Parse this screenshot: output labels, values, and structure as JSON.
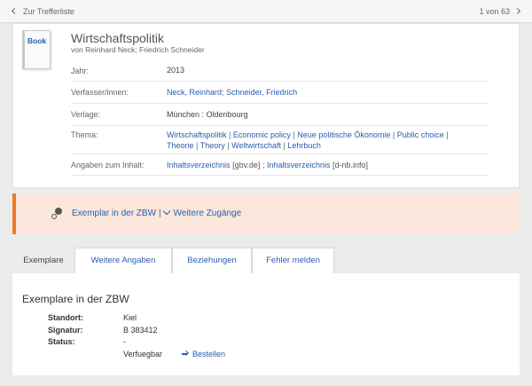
{
  "topbar": {
    "back_label": "Zur Trefferliste",
    "pager": "1 von 63"
  },
  "record": {
    "icon_label": "Book",
    "title": "Wirtschaftspolitik",
    "byline": "von Reinhard Neck; Friedrich Schneider",
    "fields": {
      "jahr": {
        "label": "Jahr:",
        "value": "2013"
      },
      "verfasser": {
        "label": "Verfasser/innen:",
        "authors": [
          "Neck, Reinhard",
          "Schneider, Friedrich"
        ],
        "sep": ";"
      },
      "verlage": {
        "label": "Verlage:",
        "value": "München : Oldenbourg"
      },
      "thema": {
        "label": "Thema:",
        "topics": [
          "Wirtschaftspolitik",
          "Economic policy",
          "Neue politische Ökonomie",
          "Public choice",
          "Theorie",
          "Theory",
          "Weltwirtschaft",
          "Lehrbuch"
        ],
        "sep": "|"
      },
      "inhalt": {
        "label": "Angaben zum Inhalt:",
        "link1": "Inhaltsverzeichnis",
        "source1": "[gbv.de]",
        "sep": ";",
        "link2": "Inhaltsverzeichnis",
        "source2": "[d-nb.info]"
      }
    }
  },
  "access": {
    "zbw_label": "Exemplar in der ZBW",
    "pipe": "|",
    "more_label": "Weitere Zugänge"
  },
  "tabs": {
    "exemplare": "Exemplare",
    "weitere": "Weitere Angaben",
    "beziehungen": "Beziehungen",
    "fehler": "Fehler melden"
  },
  "holdings": {
    "heading": "Exemplare in der ZBW",
    "standort_label": "Standort:",
    "standort": "Kiel",
    "signatur_label": "Signatur:",
    "signatur": "B 383412",
    "status_label": "Status:",
    "status": "-",
    "availability": "Verfuegbar",
    "order_label": "Bestellen"
  }
}
